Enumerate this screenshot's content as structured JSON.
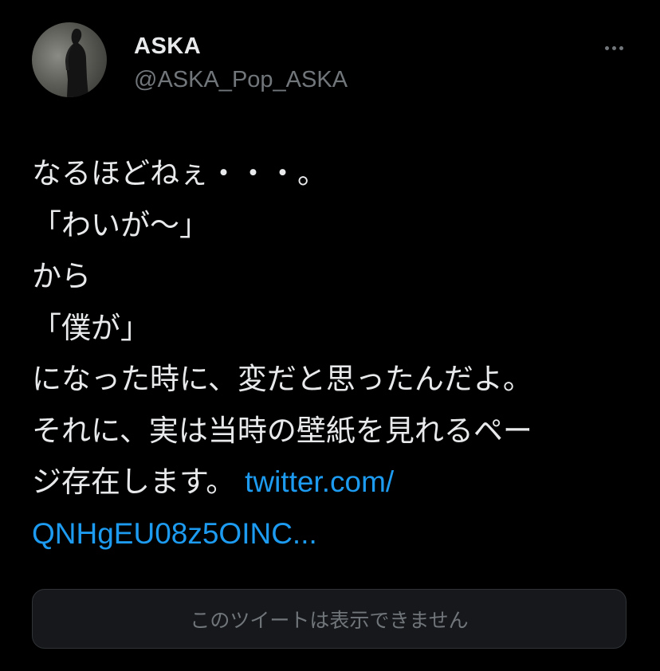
{
  "user": {
    "display_name": "ASKA",
    "handle": "@ASKA_Pop_ASKA"
  },
  "menu": {
    "more_icon": "more-horizontal-icon"
  },
  "tweet": {
    "lines": [
      "なるほどねぇ・・・。",
      "「わいが〜」",
      "から",
      "「僕が」",
      "になった時に、変だと思ったんだよ。",
      "それに、実は当時の壁紙を見れるペー",
      "ジ存在します。"
    ],
    "link_part1": "twitter.com/",
    "link_part2": "QNHgEU08z5OINC..."
  },
  "quoted": {
    "unavailable_text": "このツイートは表示できません"
  },
  "colors": {
    "background": "#000000",
    "text": "#e7e9ea",
    "secondary": "#71767b",
    "link": "#1d9bf0",
    "card_bg": "#16181c",
    "card_border": "#2f3336"
  }
}
